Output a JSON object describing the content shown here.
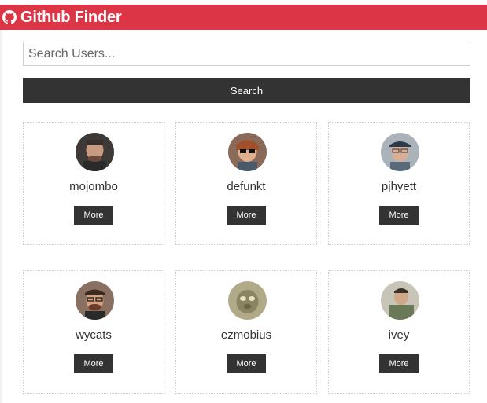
{
  "navbar": {
    "icon": "github-icon",
    "title": "Github Finder",
    "color": "#dc3545"
  },
  "search": {
    "placeholder": "Search Users...",
    "value": "",
    "button_label": "Search"
  },
  "users": [
    {
      "login": "mojombo",
      "more_label": "More",
      "avatar_bg": "#5a4a40"
    },
    {
      "login": "defunkt",
      "more_label": "More",
      "avatar_bg": "#a05a3a"
    },
    {
      "login": "pjhyett",
      "more_label": "More",
      "avatar_bg": "#7a8a9a"
    },
    {
      "login": "wycats",
      "more_label": "More",
      "avatar_bg": "#6a4a3a"
    },
    {
      "login": "ezmobius",
      "more_label": "More",
      "avatar_bg": "#9a9470"
    },
    {
      "login": "ivey",
      "more_label": "More",
      "avatar_bg": "#7a7060"
    }
  ]
}
